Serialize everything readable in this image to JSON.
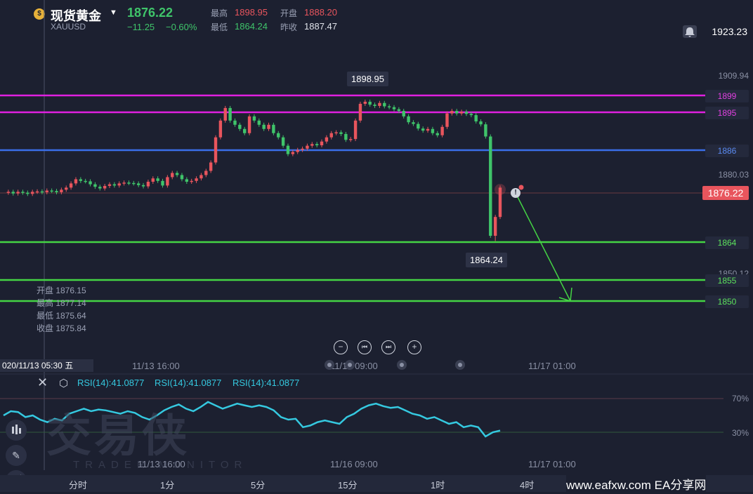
{
  "header": {
    "icon": "gold-coin-icon",
    "name": "现货黄金",
    "code": "XAUUSD",
    "price": "1876.22",
    "change": "−11.25",
    "change_pct": "−0.60%",
    "high_label": "最高",
    "high": "1898.95",
    "open_label": "开盘",
    "open": "1888.20",
    "low_label": "最低",
    "low": "1864.24",
    "prev_label": "昨收",
    "prev": "1887.47"
  },
  "axis": {
    "top_price": "1923.23",
    "ticks": [
      "1909.94",
      "1880.03",
      "1850.12"
    ],
    "current_price": "1876.22"
  },
  "levels": [
    {
      "value": "1899",
      "color": "#e020e0"
    },
    {
      "value": "1895",
      "color": "#e020e0"
    },
    {
      "value": "1886",
      "color": "#3a6ee8"
    },
    {
      "value": "1864",
      "color": "#44d444"
    },
    {
      "value": "1855",
      "color": "#44d444"
    },
    {
      "value": "1850",
      "color": "#44d444"
    }
  ],
  "callouts": {
    "high": "1898.95",
    "low": "1864.24"
  },
  "ohlc_panel": {
    "open": "开盘 1876.15",
    "high": "最高 1877.14",
    "low": "最低 1875.64",
    "close": "收盘 1875.84"
  },
  "zoom": {
    "zoom_out": "−",
    "prev": "⏮",
    "next": "⏭",
    "zoom_in": "+"
  },
  "xaxis": {
    "cursor_date": "020/11/13 05:30 五",
    "labels": [
      "11/13 16:00",
      "11/16 09:00",
      "11/17 01:00"
    ]
  },
  "rsi": {
    "labels": [
      "RSI(14):41.0877",
      "RSI(14):41.0877",
      "RSI(14):41.0877"
    ],
    "levels": [
      "70%",
      "30%"
    ],
    "xlabels": [
      "11/13 16:00",
      "11/16 09:00",
      "11/17 01:00"
    ]
  },
  "watermark": {
    "cn": "交易侠",
    "en": "TRADER MONITOR"
  },
  "timeframes": [
    "分时",
    "1分",
    "5分",
    "15分",
    "1时",
    "4时"
  ],
  "footer": "www.eafxw.com  EA分享网",
  "colors": {
    "up": "#e8555d",
    "down": "#3fc46a",
    "rsi": "#35c9e0",
    "bg": "#1c2030"
  }
}
